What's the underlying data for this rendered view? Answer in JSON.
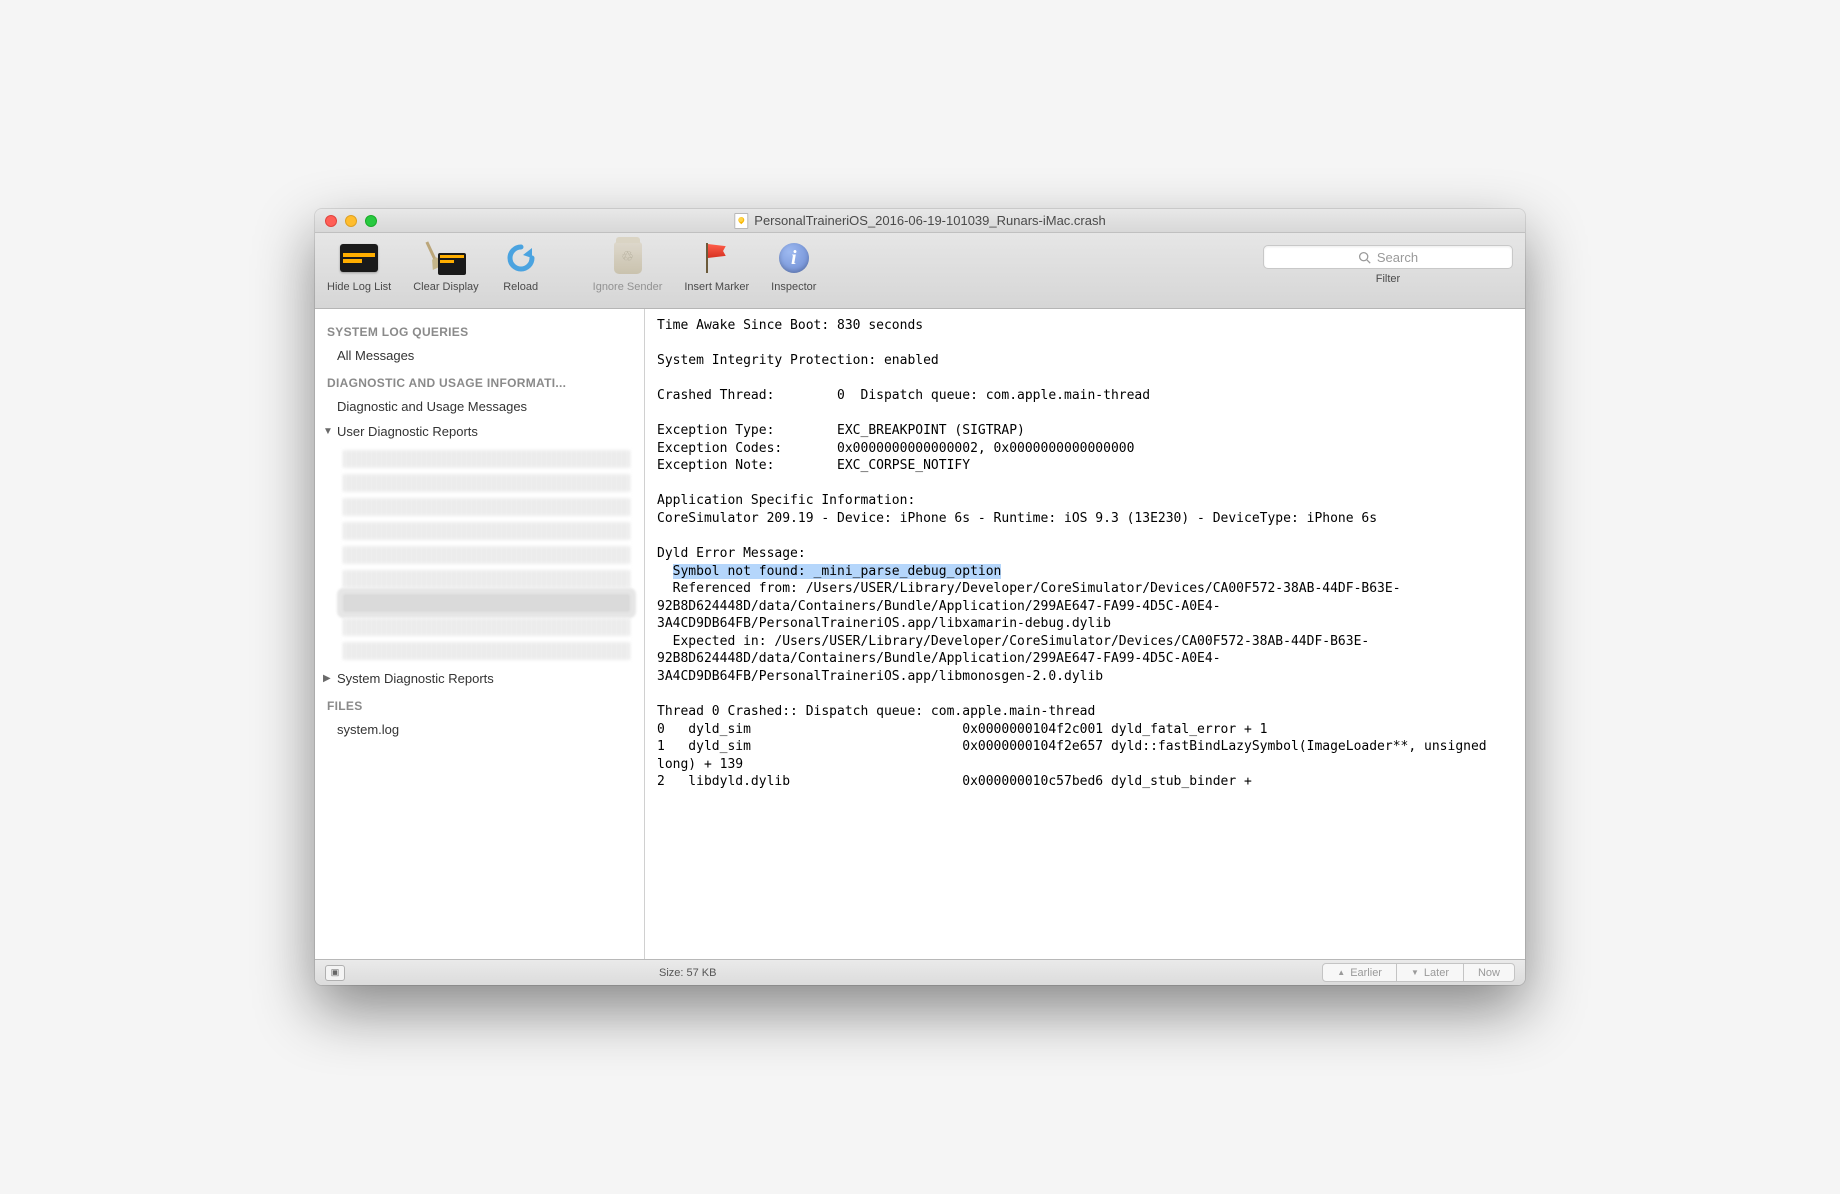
{
  "window": {
    "title": "PersonalTraineriOS_2016-06-19-101039_Runars-iMac.crash"
  },
  "toolbar": {
    "hide_log_list": "Hide Log List",
    "clear_display": "Clear Display",
    "reload": "Reload",
    "ignore_sender": "Ignore Sender",
    "insert_marker": "Insert Marker",
    "inspector": "Inspector",
    "filter_label": "Filter",
    "search_placeholder": "Search"
  },
  "sidebar": {
    "section_system_log": "SYSTEM LOG QUERIES",
    "all_messages": "All Messages",
    "section_diag": "DIAGNOSTIC AND USAGE INFORMATI...",
    "diag_messages": "Diagnostic and Usage Messages",
    "user_diag_reports": "User Diagnostic Reports",
    "system_diag_reports": "System Diagnostic Reports",
    "section_files": "FILES",
    "system_log": "system.log"
  },
  "log": {
    "l1": "Time Awake Since Boot: 830 seconds",
    "l2": "System Integrity Protection: enabled",
    "l3": "Crashed Thread:        0  Dispatch queue: com.apple.main-thread",
    "l4": "Exception Type:        EXC_BREAKPOINT (SIGTRAP)",
    "l5": "Exception Codes:       0x0000000000000002, 0x0000000000000000",
    "l6": "Exception Note:        EXC_CORPSE_NOTIFY",
    "l7": "Application Specific Information:",
    "l8": "CoreSimulator 209.19 - Device: iPhone 6s - Runtime: iOS 9.3 (13E230) - DeviceType: iPhone 6s",
    "l9": "Dyld Error Message:",
    "l10_pre": "  ",
    "l10_hi": "Symbol not found: _mini_parse_debug_option",
    "l11": "  Referenced from: /Users/USER/Library/Developer/CoreSimulator/Devices/CA00F572-38AB-44DF-B63E-92B8D624448D/data/Containers/Bundle/Application/299AE647-FA99-4D5C-A0E4-3A4CD9DB64FB/PersonalTraineriOS.app/libxamarin-debug.dylib",
    "l12": "  Expected in: /Users/USER/Library/Developer/CoreSimulator/Devices/CA00F572-38AB-44DF-B63E-92B8D624448D/data/Containers/Bundle/Application/299AE647-FA99-4D5C-A0E4-3A4CD9DB64FB/PersonalTraineriOS.app/libmonosgen-2.0.dylib",
    "l13": "Thread 0 Crashed:: Dispatch queue: com.apple.main-thread",
    "l14": "0   dyld_sim                           0x0000000104f2c001 dyld_fatal_error + 1",
    "l15": "1   dyld_sim                           0x0000000104f2e657 dyld::fastBindLazySymbol(ImageLoader**, unsigned long) + 139",
    "l16": "2   libdyld.dylib                      0x000000010c57bed6 dyld_stub_binder + "
  },
  "status": {
    "size": "Size: 57 KB",
    "earlier": "Earlier",
    "later": "Later",
    "now": "Now"
  }
}
